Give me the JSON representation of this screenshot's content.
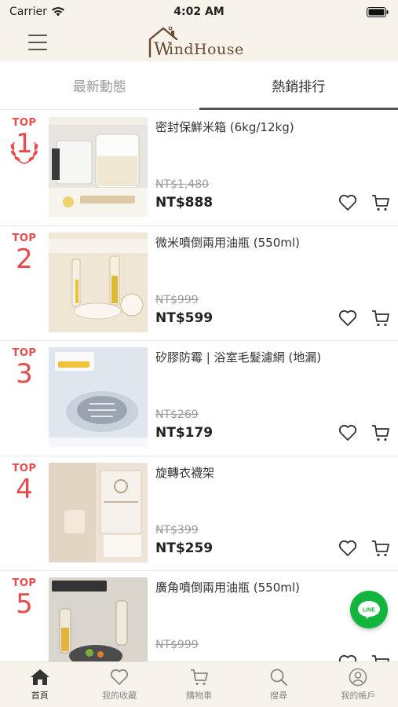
{
  "status_bar": {
    "carrier": "Carrier",
    "time": "4:02 AM"
  },
  "header": {
    "logo_text": "indHouse",
    "logo_letter": "W"
  },
  "tabs": [
    {
      "label": "最新動態",
      "active": false
    },
    {
      "label": "熱銷排行",
      "active": true
    }
  ],
  "rank_prefix": "TOP",
  "products": [
    {
      "rank": "1",
      "name": "密封保鮮米箱 (6kg/12kg)",
      "original_price": "NT$1,480",
      "price": "NT$888",
      "thumb_color": "#e8e4df"
    },
    {
      "rank": "2",
      "name": "微米噴倒兩用油瓶 (550ml)",
      "original_price": "NT$999",
      "price": "NT$599",
      "thumb_color": "#efe6d6"
    },
    {
      "rank": "3",
      "name": "矽膠防霉 | 浴室毛髮濾網 (地漏)",
      "original_price": "NT$269",
      "price": "NT$179",
      "thumb_color": "#dfe6ee"
    },
    {
      "rank": "4",
      "name": "旋轉衣襪架",
      "original_price": "NT$399",
      "price": "NT$259",
      "thumb_color": "#ece2d6"
    },
    {
      "rank": "5",
      "name": "廣角噴倒兩用油瓶 (550ml)",
      "original_price": "NT$999",
      "price": "",
      "thumb_color": "#d9d4cc"
    }
  ],
  "bottom_nav": [
    {
      "label": "首頁",
      "icon": "home-icon",
      "active": true
    },
    {
      "label": "我的收藏",
      "icon": "heart-icon",
      "active": false
    },
    {
      "label": "購物車",
      "icon": "cart-icon",
      "active": false
    },
    {
      "label": "搜尋",
      "icon": "search-icon",
      "active": false
    },
    {
      "label": "我的帳戶",
      "icon": "user-icon",
      "active": false
    }
  ],
  "line_button": {
    "label": "LINE",
    "color": "#12b53d"
  },
  "colors": {
    "accent": "#e94b4b",
    "header_bg": "#f7f3ea",
    "logo": "#6b4b33"
  }
}
